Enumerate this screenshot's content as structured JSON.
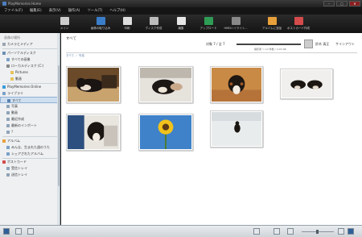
{
  "window": {
    "title": "PlayMemories Home"
  },
  "menu": [
    "ファイル(F)",
    "編集(E)",
    "表示(V)",
    "操作(A)",
    "ツール(T)",
    "ヘルプ(H)"
  ],
  "toolbar": [
    {
      "label": "メイン",
      "icon": "calendar-icon",
      "color": "#cccccc"
    },
    {
      "label": "画像の取り込み",
      "icon": "import-icon",
      "color": "#3a7dc9"
    },
    {
      "label": "印刷",
      "icon": "print-icon",
      "color": "#dddddd"
    },
    {
      "label": "ディスク作成",
      "icon": "disc-icon",
      "color": "#bbbbbb"
    },
    {
      "label": "編集",
      "icon": "edit-icon",
      "color": "#e6e6e6"
    },
    {
      "label": "アップロード",
      "icon": "upload-icon",
      "color": "#2e9c55"
    },
    {
      "label": "HMDハイライト...",
      "icon": "film-icon",
      "color": "#888888"
    },
    {
      "label": "アルバムに追加",
      "icon": "album-add-icon",
      "color": "#e8a03a"
    },
    {
      "label": "ポストカード作成",
      "icon": "postcard-icon",
      "color": "#d44b4b"
    }
  ],
  "sidebar": {
    "heading": "画像の場所",
    "items": [
      {
        "label": "カメラとメディア",
        "indent": 0,
        "icon": "camera-icon",
        "color": "#9aa4ae"
      },
      {
        "label": "パーソナルディスク",
        "indent": 0,
        "icon": "pc-icon",
        "color": "#6d8fb3"
      },
      {
        "label": "すべての画像",
        "indent": 1,
        "icon": "images-icon",
        "color": "#7aa0c7"
      },
      {
        "label": "ローカルディスク (C:)",
        "indent": 1,
        "icon": "drive-icon",
        "color": "#888888"
      },
      {
        "label": "Pictures",
        "indent": 2,
        "icon": "folder-icon",
        "color": "#e8c25a"
      },
      {
        "label": "動画",
        "indent": 2,
        "icon": "folder-icon",
        "color": "#e8c25a"
      },
      {
        "label": "PlayMemories Online",
        "indent": 0,
        "icon": "cloud-icon",
        "color": "#3a9ad9"
      },
      {
        "label": "ライブラリ",
        "indent": 0,
        "icon": "library-icon",
        "color": "#7aa0c7"
      },
      {
        "label": "すべて",
        "indent": 1,
        "icon": "grid-icon",
        "color": "#5b83b0",
        "selected": true
      },
      {
        "label": "写真",
        "indent": 1,
        "icon": "photo-icon",
        "color": "#8fa3b8"
      },
      {
        "label": "動画",
        "indent": 1,
        "icon": "video-icon",
        "color": "#8fa3b8"
      },
      {
        "label": "最近作成",
        "indent": 1,
        "icon": "recent-icon",
        "color": "#8fa3b8"
      },
      {
        "label": "最新のインポート",
        "indent": 1,
        "icon": "import-icon",
        "color": "#8fa3b8"
      },
      {
        "label": "?",
        "indent": 1,
        "icon": "help-icon",
        "color": "#8fa3b8"
      },
      {
        "label": "アルバム",
        "indent": 0,
        "icon": "album-icon",
        "color": "#e8a03a"
      },
      {
        "label": "みんな、生まれた週のうた",
        "indent": 1,
        "icon": "album-icon",
        "color": "#7aa0c7"
      },
      {
        "label": "シェアされたアルバム",
        "indent": 1,
        "icon": "share-icon",
        "color": "#7aa0c7"
      },
      {
        "label": "ポストカード",
        "indent": 0,
        "icon": "postcard-icon",
        "color": "#d44b4b"
      },
      {
        "label": "受信トレイ",
        "indent": 1,
        "icon": "inbox-icon",
        "color": "#8fa3b8"
      },
      {
        "label": "送信トレイ",
        "indent": 1,
        "icon": "outbox-icon",
        "color": "#8fa3b8"
      }
    ]
  },
  "main": {
    "title": "すべて",
    "count": "対象 7 / 全 7",
    "sub": "撮影者 ～ 12 件数 / 1.02 GB",
    "user": "鈴木 清正",
    "signout": "サインアウト",
    "crumb": "すべて ／ 写真"
  },
  "photos": [
    {
      "name": "dog-on-sofa"
    },
    {
      "name": "puppy-in-hand"
    },
    {
      "name": "puppy-on-floor"
    },
    {
      "name": "two-puppies"
    },
    {
      "name": "puppy-held"
    },
    {
      "name": "sunflower"
    },
    {
      "name": "dog-in-snow"
    }
  ]
}
